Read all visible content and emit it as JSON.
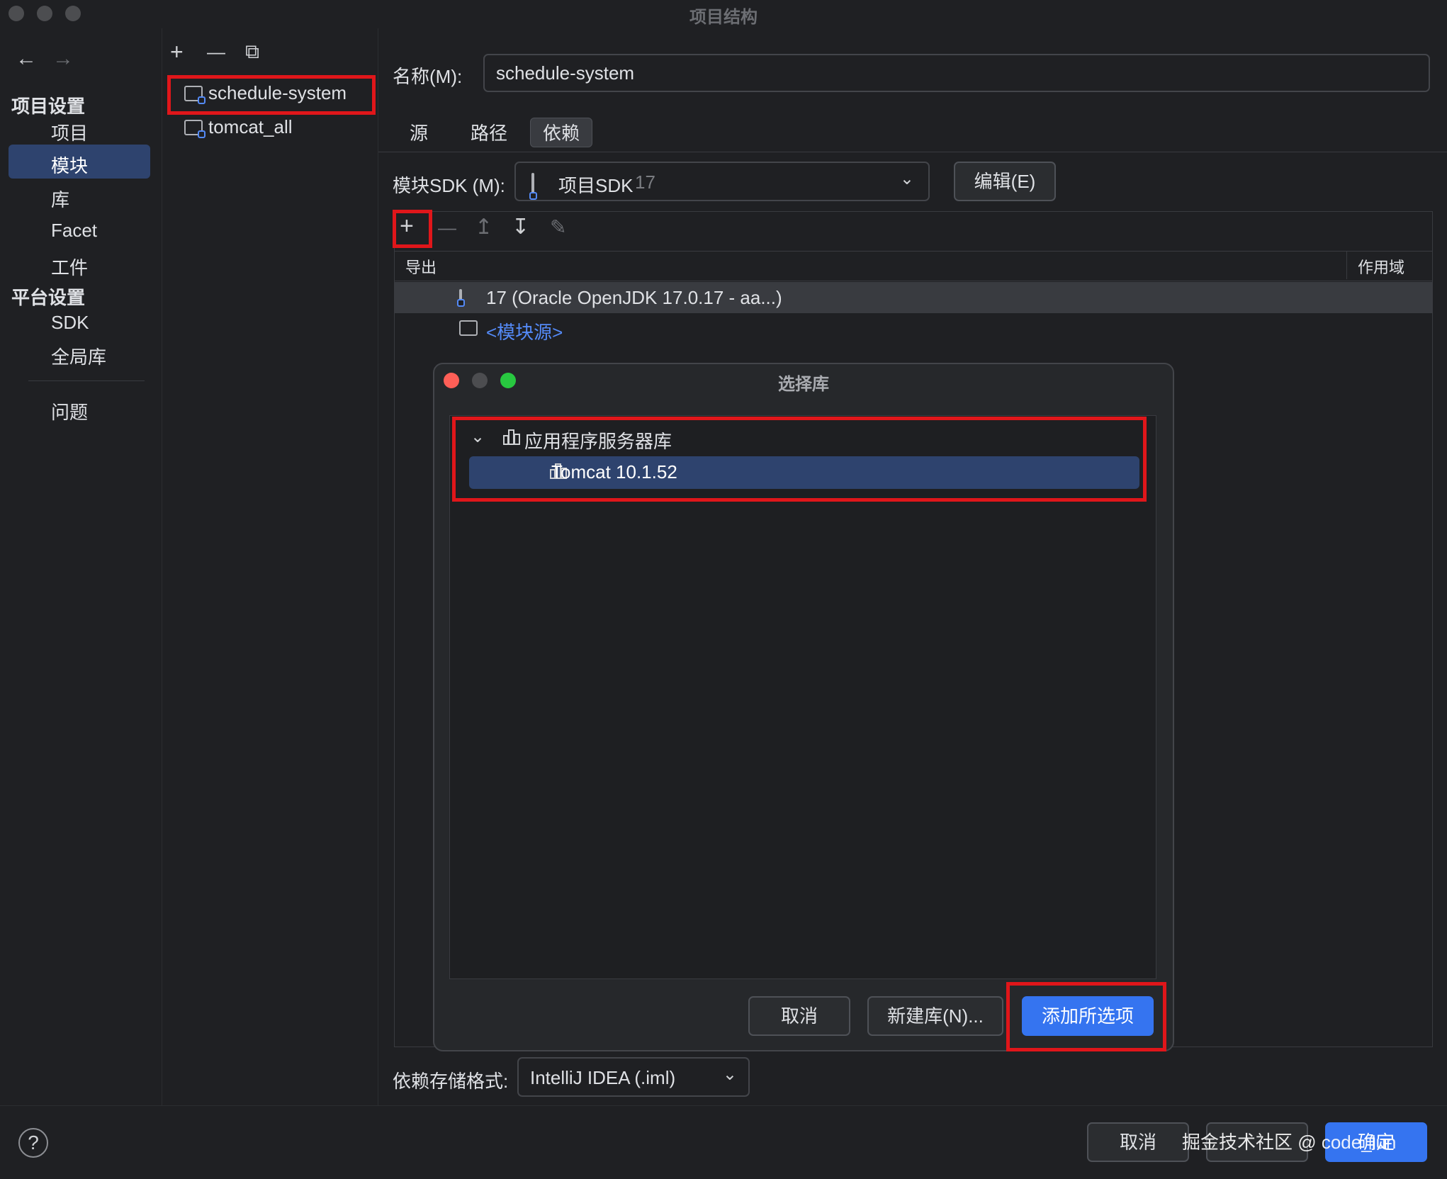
{
  "window": {
    "title": "项目结构"
  },
  "sidebar": {
    "back": "←",
    "forward": "→",
    "section_project": "项目设置",
    "items_project": [
      "项目",
      "模块",
      "库",
      "Facet",
      "工件"
    ],
    "section_platform": "平台设置",
    "items_platform": [
      "SDK",
      "全局库"
    ],
    "problems": "问题"
  },
  "modules": {
    "toolbar": {
      "add": "+",
      "remove": "—",
      "copy": "⧉"
    },
    "items": [
      "schedule-system",
      "tomcat_all"
    ]
  },
  "main": {
    "name_label": "名称(M):",
    "name_value": "schedule-system",
    "tabs": [
      "源",
      "路径",
      "依赖"
    ],
    "active_tab": "依赖",
    "sdk_label": "模块SDK (M):",
    "sdk_value": "项目SDK",
    "sdk_version": "17",
    "edit_button": "编辑(E)",
    "deps_toolbar": {
      "add": "+",
      "remove": "—",
      "up": "↥",
      "down": "↧",
      "edit": "✎"
    },
    "col_export": "导出",
    "col_scope": "作用域",
    "deps": [
      {
        "label": "17 (Oracle OpenJDK 17.0.17 - aa...)"
      },
      {
        "label": "<模块源>"
      }
    ],
    "storage_label": "依赖存储格式:",
    "storage_value": "IntelliJ IDEA (.iml)"
  },
  "dialog": {
    "title": "选择库",
    "group": "应用程序服务器库",
    "item": "Tomcat 10.1.52",
    "cancel": "取消",
    "new_lib": "新建库(N)...",
    "add_selected": "添加所选项"
  },
  "footer": {
    "help": "?",
    "cancel": "取消",
    "ok": "确定",
    "watermark": "掘金技术社区 @ code_lun"
  },
  "colors": {
    "accent": "#3574f0",
    "selection": "#2e436e",
    "highlight_box": "#e0161a",
    "background": "#1f2023"
  }
}
